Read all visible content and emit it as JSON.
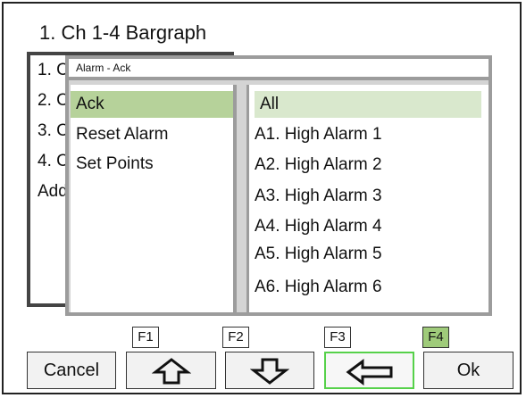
{
  "screen": {
    "title": "1.  Ch 1-4 Bargraph"
  },
  "background_menu": {
    "items": [
      "1. C",
      "2. C",
      "3. C",
      "4. C",
      "Add"
    ]
  },
  "popup": {
    "title": "Alarm - Ack",
    "left_items": [
      "Ack",
      "Reset Alarm",
      "Set Points"
    ],
    "left_selected": "Ack",
    "right_items": [
      "All",
      "A1. High Alarm 1",
      "A2. High Alarm 2",
      "A3. High Alarm 3",
      "A4. High Alarm 4",
      "A5. High Alarm 5",
      "A6. High Alarm 6"
    ],
    "right_selected": "All"
  },
  "function_keys": [
    "F1",
    "F2",
    "F3",
    "F4"
  ],
  "active_function_key": "F4",
  "buttons": {
    "cancel": "Cancel",
    "up_icon": "up-arrow-icon",
    "down_icon": "down-arrow-icon",
    "back_icon": "left-arrow-icon",
    "ok": "Ok"
  },
  "colors": {
    "selection_left": "#b6d29a",
    "selection_right": "#d9e8cd",
    "active_key": "#9fcb7a",
    "active_button_border": "#56d14a"
  }
}
